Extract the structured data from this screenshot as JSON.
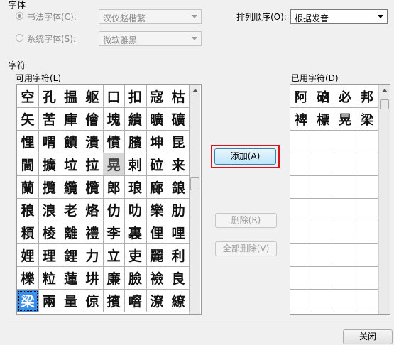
{
  "font_group": {
    "title": "字体",
    "calligraphy_radio": "书法字体(C):",
    "calligraphy_value": "汉仪赵楷繁",
    "system_radio": "系统字体(S):",
    "system_value": "微软雅黑",
    "sort_label": "排列顺序(O):",
    "sort_value": "根据发音"
  },
  "chars_group": {
    "title": "字符",
    "available_label": "可用字符(L)",
    "used_label": "已用字符(D)",
    "available_chars": [
      [
        "空",
        "孔",
        "揾",
        "躯",
        "口",
        "扣",
        "寇",
        "枯"
      ],
      [
        "矢",
        "苦",
        "庫",
        "儈",
        "塊",
        "繢",
        "曠",
        "礦"
      ],
      [
        "悝",
        "喟",
        "饋",
        "潰",
        "憤",
        "臏",
        "坤",
        "昆"
      ],
      [
        "閫",
        "擴",
        "垃",
        "拉",
        "晃",
        "剌",
        "砬",
        "来"
      ],
      [
        "蘭",
        "攬",
        "纜",
        "欖",
        "郎",
        "琅",
        "廊",
        "鋃"
      ],
      [
        "稂",
        "浪",
        "老",
        "烙",
        "仂",
        "叻",
        "樂",
        "肋"
      ],
      [
        "頪",
        "棱",
        "離",
        "禮",
        "李",
        "裏",
        "俚",
        "哩"
      ],
      [
        "娌",
        "理",
        "鋰",
        "力",
        "立",
        "吏",
        "麗",
        "利"
      ],
      [
        "櫟",
        "粒",
        "蓮",
        "㘫",
        "廉",
        "臉",
        "襝",
        "良"
      ],
      [
        "梁",
        "兩",
        "量",
        "倞",
        "擯",
        "噾",
        "潦",
        "繚"
      ]
    ],
    "selected_char": "梁",
    "gray_char": "晃",
    "used_chars": [
      [
        "阿",
        "硇",
        "必",
        "邦"
      ],
      [
        "裨",
        "標",
        "晃",
        "梁"
      ]
    ]
  },
  "buttons": {
    "add": "添加(A)",
    "delete": "删除(R)",
    "delete_all": "全部删除(V)",
    "close": "关闭"
  }
}
